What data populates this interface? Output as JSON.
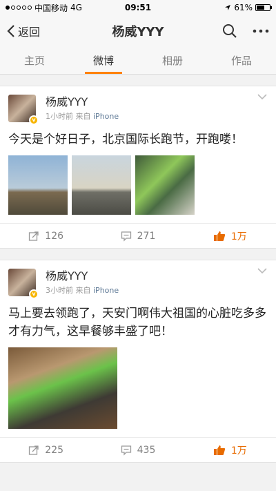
{
  "status_bar": {
    "carrier": "中国移动",
    "network": "4G",
    "time": "09:51",
    "battery": "61%",
    "battery_level": 0.61
  },
  "nav": {
    "back_label": "返回",
    "title": "杨威YYY"
  },
  "tabs": [
    {
      "label": "主页"
    },
    {
      "label": "微博"
    },
    {
      "label": "相册"
    },
    {
      "label": "作品"
    }
  ],
  "posts": [
    {
      "username": "杨威YYY",
      "time": "1小时前",
      "source_prefix": "来自",
      "source": "iPhone",
      "text": "今天是个好日子，北京国际长跑节，开跑喽！",
      "reposts": "126",
      "comments": "271",
      "likes": "1万"
    },
    {
      "username": "杨威YYY",
      "time": "3小时前",
      "source_prefix": "来自",
      "source": "iPhone",
      "text": "马上要去领跑了，天安门啊伟大祖国的心脏吃多多才有力气，这早餐够丰盛了吧！",
      "reposts": "225",
      "comments": "435",
      "likes": "1万"
    }
  ],
  "colors": {
    "accent": "#ff8200",
    "verified": "#f7b500",
    "source_link": "#5d7895"
  }
}
